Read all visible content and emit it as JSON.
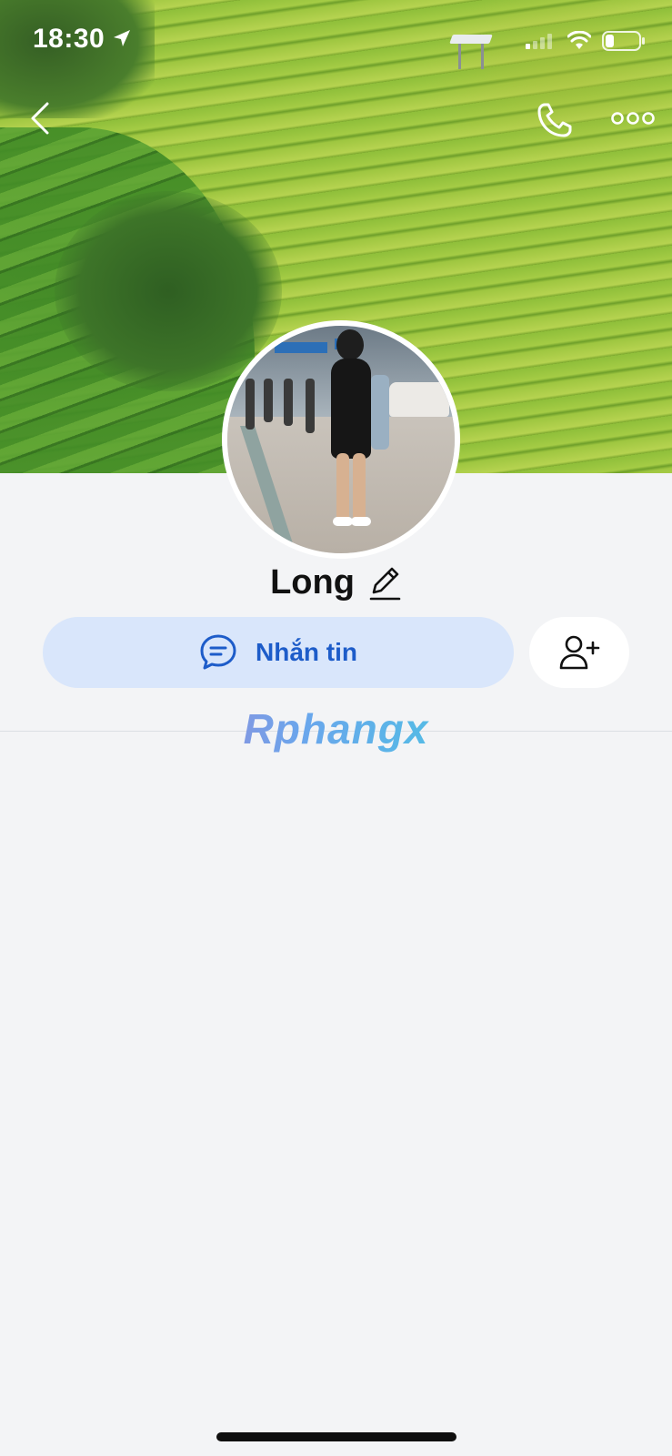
{
  "status_bar": {
    "time": "18:30",
    "location_icon": "location-arrow-icon",
    "signal_icon": "cellular-signal-icon",
    "wifi_icon": "wifi-icon",
    "battery_icon": "battery-icon"
  },
  "nav": {
    "back_icon": "chevron-left-icon",
    "call_icon": "phone-icon",
    "more_icon": "more-horizontal-icon"
  },
  "profile": {
    "name": "Long",
    "edit_icon": "pencil-icon"
  },
  "actions": {
    "message_label": "Nhắn tin",
    "message_icon": "chat-bubble-icon",
    "add_friend_icon": "person-add-icon"
  },
  "watermark": {
    "text": "Rphangx"
  },
  "colors": {
    "accent": "#1d5cc9",
    "message_button_bg": "#d9e6fb",
    "background": "#f3f4f6"
  }
}
